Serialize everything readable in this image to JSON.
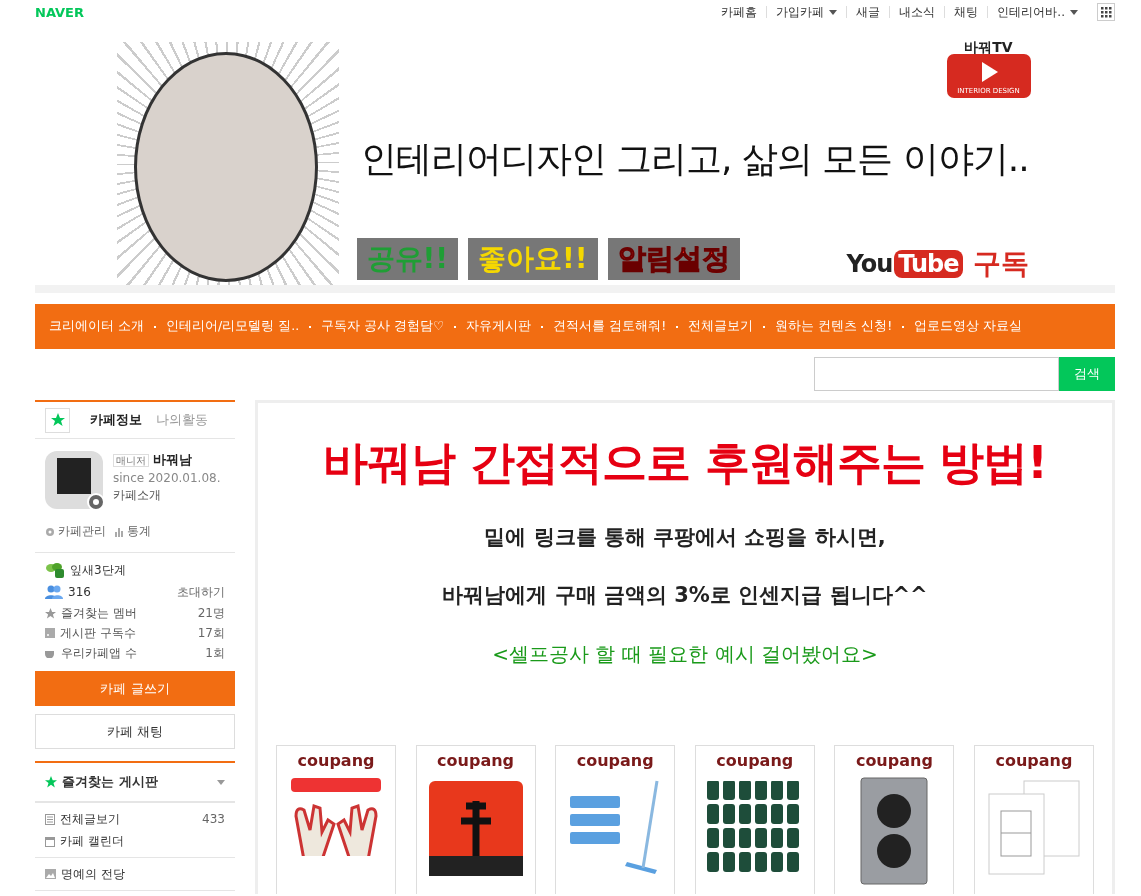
{
  "topbar": {
    "logo": "NAVER",
    "links": [
      {
        "label": "카페홈",
        "dropdown": false
      },
      {
        "label": "가입카페",
        "dropdown": true
      },
      {
        "label": "새글",
        "dropdown": false
      },
      {
        "label": "내소식",
        "dropdown": false
      },
      {
        "label": "채팅",
        "dropdown": false
      },
      {
        "label": "인테리어바..",
        "dropdown": true
      }
    ]
  },
  "banner": {
    "channel": "바꿔TV",
    "channel_sub": "INTERIOR DESIGN",
    "headline": "인테리어디자인 그리고, 삶의 모든 이야기..",
    "badges": [
      {
        "kind": "share",
        "label": "공유!!"
      },
      {
        "kind": "like",
        "label": "좋아요!!"
      },
      {
        "kind": "alert",
        "label": "알림설정"
      }
    ],
    "youtube": "You",
    "youtube_tube": "Tube",
    "subscribe": "구독"
  },
  "menu": [
    "크리에이터 소개",
    "인테리어/리모델링 질..",
    "구독자 공사 경험담♡",
    "자유게시판",
    "견적서를 검토해줘!",
    "전체글보기",
    "원하는 컨텐츠 신청!",
    "업로드영상 자료실"
  ],
  "search": {
    "button": "검색"
  },
  "sidebar": {
    "tabs": [
      {
        "label": "카페정보",
        "selected": true
      },
      {
        "label": "나의활동",
        "selected": false
      }
    ],
    "manager_tag": "매니저",
    "manager": "바꿔남",
    "since": "since 2020.01.08.",
    "intro": "카페소개",
    "admin_links": [
      "카페관리",
      "통계"
    ],
    "level": "잎새3단계",
    "members": "316",
    "invite": "초대하기",
    "stats": [
      {
        "kind": "star",
        "label": "즐겨찾는 멤버",
        "value": "21명"
      },
      {
        "kind": "rss",
        "label": "게시판 구독수",
        "value": "17회"
      },
      {
        "kind": "cup",
        "label": "우리카페앱 수",
        "value": "1회"
      }
    ],
    "write_button": "카페 글쓰기",
    "chat_button": "카페 채팅",
    "favorites_title": "즐겨찾는 게시판",
    "boards": [
      {
        "kind": "list",
        "label": "전체글보기",
        "count": "433"
      },
      {
        "kind": "calendar",
        "label": "카페 캘린더"
      }
    ],
    "more_boards": [
      {
        "kind": "image",
        "label": "명예의 전당"
      }
    ]
  },
  "post": {
    "title": "바꿔남 간접적으로 후원해주는 방법!",
    "lines": [
      "밑에 링크를 통해 쿠팡에서 쇼핑을 하시면,",
      "바꿔남에게 구매 금액의 3%로 인센지급 됩니다^^"
    ],
    "note": "<셀프공사 할 때 필요한 예시 걸어봤어요>",
    "products": [
      {
        "kind": "gloves",
        "brand": "coupang"
      },
      {
        "kind": "ramen",
        "brand": "coupang"
      },
      {
        "kind": "mop",
        "brand": "coupang"
      },
      {
        "kind": "drinks",
        "brand": "coupang"
      },
      {
        "kind": "outlet",
        "brand": "coupang"
      },
      {
        "kind": "switch",
        "brand": "coupang"
      }
    ]
  }
}
